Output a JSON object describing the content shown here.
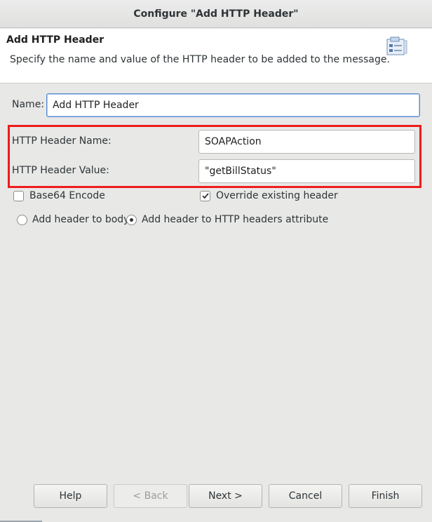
{
  "window": {
    "title": "Configure \"Add HTTP Header\""
  },
  "header": {
    "title": "Add HTTP Header",
    "description": "Specify the name and value of the HTTP header to be added to the message.",
    "icon": "clipboard-list-icon"
  },
  "form": {
    "name_label": "Name:",
    "name_value": "Add HTTP Header",
    "header_name_label": "HTTP Header Name:",
    "header_name_value": "SOAPAction",
    "header_value_label": "HTTP Header Value:",
    "header_value_value": "\"getBillStatus\"",
    "base64_label": "Base64 Encode",
    "base64_checked": false,
    "override_label": "Override existing header",
    "override_checked": true,
    "radio_body_label": "Add header to body",
    "radio_attr_label": "Add header to HTTP headers attribute",
    "radio_selected": "attribute"
  },
  "buttons": {
    "help": "Help",
    "back": "< Back",
    "next": "Next >",
    "cancel": "Cancel",
    "finish": "Finish"
  },
  "colors": {
    "highlight": "#ee1c1c",
    "focus": "#5b8fd1"
  }
}
